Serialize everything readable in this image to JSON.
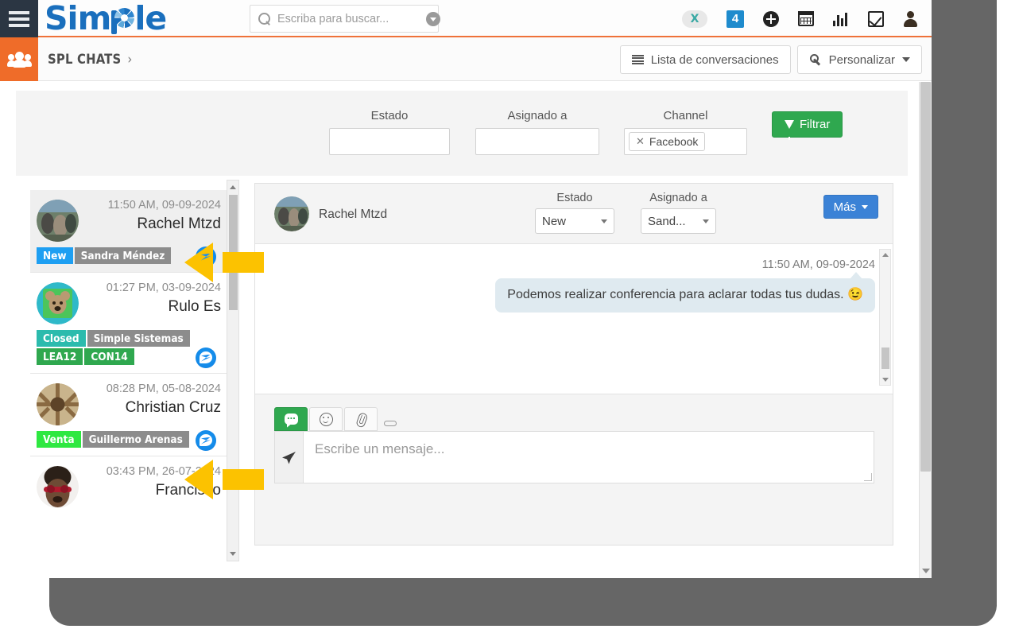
{
  "header": {
    "menu_icon": "hamburger-icon",
    "logo_text_before": "Sim",
    "logo_text_after": "le",
    "search": {
      "placeholder": "Escriba para buscar...",
      "value": "",
      "icon": "search-icon",
      "dropdown_icon": "chevron-down-circle-icon"
    },
    "icons": [
      {
        "name": "x-logo-icon",
        "label": "X"
      },
      {
        "name": "notifications-badge-icon",
        "label": "4"
      },
      {
        "name": "add-plus-icon",
        "label": ""
      },
      {
        "name": "calendar-icon",
        "label": ""
      },
      {
        "name": "chart-bars-icon",
        "label": ""
      },
      {
        "name": "checkbox-tasks-icon",
        "label": ""
      },
      {
        "name": "user-profile-icon",
        "label": ""
      }
    ]
  },
  "breadcrumb": {
    "module_icon": "group-users-icon",
    "title": "SPL CHATS",
    "separator": "›",
    "buttons": [
      {
        "name": "lista-de-conversaciones-button",
        "label": "Lista de conversaciones",
        "icon": "list-icon"
      },
      {
        "name": "personalizar-button",
        "label": "Personalizar",
        "icon": "wrench-icon",
        "caret": true
      }
    ]
  },
  "filters": {
    "estado": {
      "label": "Estado",
      "value": "",
      "placeholder": ""
    },
    "asignado_a": {
      "label": "Asignado a",
      "value": "",
      "placeholder": ""
    },
    "channel": {
      "label": "Channel",
      "tag": "Facebook",
      "remove_icon": "close-x-icon"
    },
    "filter_button": {
      "label": "Filtrar",
      "icon": "funnel-icon",
      "color": "#2fa84f"
    }
  },
  "conversations": [
    {
      "name": "Rachel Mtzd",
      "time": "11:50 AM, 09-09-2024",
      "active": true,
      "tags": [
        {
          "label": "New",
          "style": "blue"
        },
        {
          "label": "Sandra Méndez",
          "style": "gray"
        }
      ],
      "channel_icon": "facebook-messenger-icon"
    },
    {
      "name": "Rulo Es",
      "time": "01:27 PM, 03-09-2024",
      "active": false,
      "tags": [
        {
          "label": "Closed",
          "style": "teal"
        },
        {
          "label": "Simple Sistemas",
          "style": "gray"
        },
        {
          "label": "LEA12",
          "style": "green"
        },
        {
          "label": "CON14",
          "style": "green"
        }
      ],
      "channel_icon": "facebook-messenger-icon"
    },
    {
      "name": "Christian Cruz",
      "time": "08:28 PM, 05-08-2024",
      "active": false,
      "tags": [
        {
          "label": "Venta",
          "style": "lgreen"
        },
        {
          "label": "Guillermo Arenas",
          "style": "gray"
        }
      ],
      "channel_icon": "facebook-messenger-icon"
    },
    {
      "name": "Francisco",
      "time": "03:43 PM, 26-07-2024",
      "active": false,
      "tags": [],
      "channel_icon": "facebook-messenger-icon"
    }
  ],
  "chat": {
    "contact_name": "Rachel Mtzd",
    "estado": {
      "label": "Estado",
      "value": "New"
    },
    "asignado_a": {
      "label": "Asignado a",
      "value": "Sand..."
    },
    "mas_button": {
      "label": "Más",
      "color": "#3b82d6"
    },
    "messages": [
      {
        "time": "11:50 AM, 09-09-2024",
        "text": "Podemos realizar conferencia para aclarar todas tus dudas. 😉",
        "side": "right"
      }
    ],
    "composer": {
      "placeholder": "Escribe un mensaje...",
      "value": "",
      "tabs": [
        {
          "name": "chat-tab",
          "icon": "chat-bubble-icon",
          "active": true
        },
        {
          "name": "emoji-tab",
          "icon": "smiley-icon",
          "active": false
        },
        {
          "name": "attachment-tab",
          "icon": "paperclip-icon",
          "active": false
        }
      ],
      "send_icon": "send-paper-plane-icon"
    }
  },
  "annotations": [
    {
      "name": "pointer-arrow-rachel",
      "target": "Rachel Mtzd tags"
    },
    {
      "name": "pointer-arrow-christian",
      "target": "Christian Cruz tags"
    }
  ]
}
